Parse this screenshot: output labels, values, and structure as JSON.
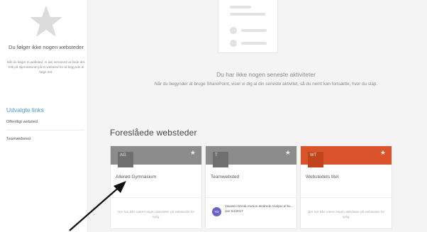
{
  "left_pane": {
    "follow_title": "Du følger ikke nogen websteder",
    "follow_desc": "Når du følger et websted, er det nemmere at finde det. Klik på stjerneikonet på et websted for at begynde at følge det.",
    "links_heading": "Udvalgte links",
    "links": [
      {
        "label": "Offentligt websted"
      },
      {
        "label": "Teamwebsted"
      }
    ]
  },
  "main": {
    "empty_title": "Du har ikke nogen seneste aktiviteter",
    "empty_desc": "Når du begynder at bruge SharePoint, viser vi dig al din seneste aktivitet, så du nemt kan fortsætte, hvor du slap.",
    "section_heading": "Foreslåede websteder",
    "cards": [
      {
        "badge": "AG",
        "title": "Allerød Gymnasium",
        "header_color": "#8c8c8c",
        "badge_color": "#6f6f6f",
        "empty_text": "Der har ikke været nogen aktiviteter på webstedet for nylig."
      },
      {
        "badge": "T",
        "title": "Teamwebsted",
        "header_color": "#8c8c8c",
        "badge_color": "#6f6f6f",
        "activity_avatar": "YD",
        "activity_text": "Yasamin Dzindu Kesion ændrede Analyse af ko... den 5/4/2017"
      },
      {
        "badge": "WT",
        "title": "Webstedets titel",
        "header_color": "#d9542b",
        "badge_color": "#c0441c",
        "empty_text": "Der har ikke været nogen aktiviteter på webstedet for nylig."
      }
    ]
  },
  "colors": {
    "accent_link": "#4b9ad4",
    "avatar": "#6b63c7"
  }
}
